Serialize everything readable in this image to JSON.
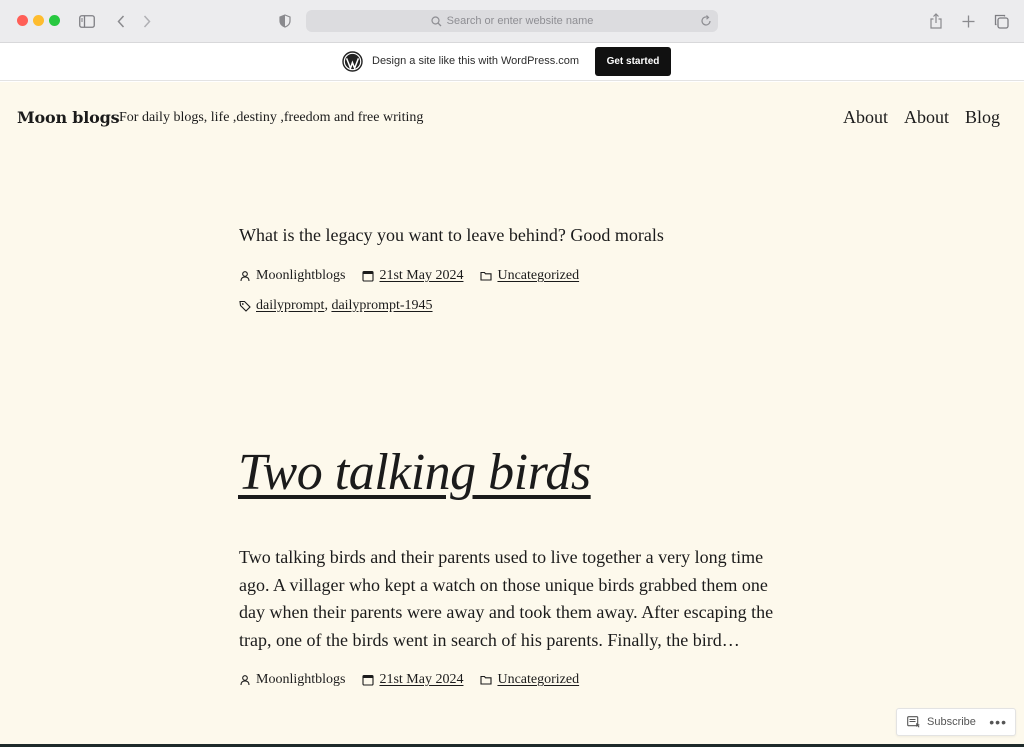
{
  "browser": {
    "url_placeholder": "Search or enter website name"
  },
  "wordpress_banner": {
    "text": "Design a site like this with WordPress.com",
    "button": "Get started"
  },
  "site": {
    "title": "Moon blogs",
    "tagline": "For daily blogs, life ,destiny ,freedom and free writing",
    "nav": [
      "About",
      "About",
      "Blog"
    ]
  },
  "posts": [
    {
      "title": "What is the legacy you want to leave behind? Good morals",
      "author": "Moonlightblogs",
      "date": "21st May 2024",
      "category": "Uncategorized",
      "tags": [
        "dailyprompt",
        "dailyprompt-1945"
      ]
    },
    {
      "title": "Two talking birds",
      "excerpt": "Two talking birds and their parents used to live together a very long time ago. A villager who kept a watch on those unique birds grabbed them one day when their parents were away and took them away. After escaping the trap, one of the birds went in search of his parents. Finally, the bird…",
      "author": "Moonlightblogs",
      "date": "21st May 2024",
      "category": "Uncategorized"
    }
  ],
  "subscribe": {
    "label": "Subscribe",
    "more": "•••"
  }
}
